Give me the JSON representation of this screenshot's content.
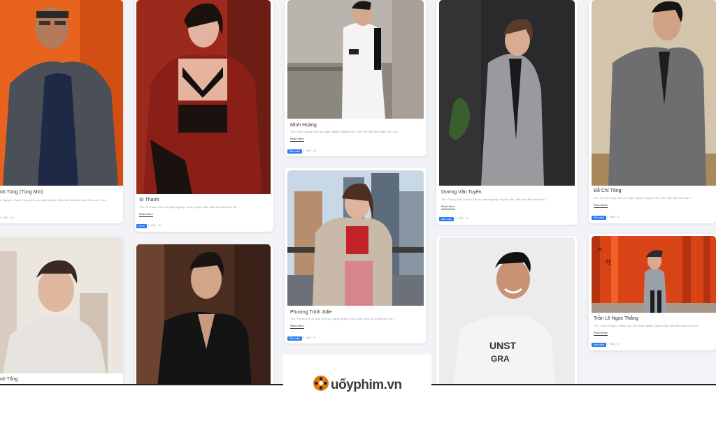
{
  "cards": {
    "c1": {
      "name": "nh Tùng (Tùng Min)",
      "desc": "n: Nguyễn Thanh Tùng Lĩnh vực nghệ nghiệp: Diễn viên Bắt bình Nam Nhu vực: HCl...",
      "stat": "2 · 6M2 · 18"
    },
    "c2": {
      "name": "SI Thanh",
      "desc": "Tên: SI Thanh Lĩnh vực nghệ nghiệp: Ca sĩ, người mẫu, diễn viên Bắt bình Nữ...",
      "readmore": "Read More",
      "badge": "Tin tổ",
      "stat": "2 · 6M2 · 16"
    },
    "c3": {
      "name": "Minh Hoàng",
      "desc": "Tên: Minh Hoàng Lĩnh vực nghệ nghiệp: Người mẫu, Diễn viên Bắt bình Nam Khu vực...",
      "readmore": "Read More",
      "badge": "Siêu mẫu",
      "stat": "2 · 6M2 · 16"
    },
    "c4": {
      "name": "Dương Văn Tuyên",
      "desc": "Tên: Dương Văn Tuyên Lĩnh vực nghệ nghiệp: Người mẫu, diễn viên Bắt bình Nam...",
      "readmore": "Read More",
      "badge": "Siêu mẫu",
      "stat": "2 · 6M2 · 16"
    },
    "c5": {
      "name": "Đỗ Chí Tông",
      "desc": "Tên: Đỗ Chí Tông Lĩnh vực nghệ nghiệp: Người mẫu, diễn viên Bắt bình Nam...",
      "readmore": "Read More",
      "badge": "Siêu mẫu",
      "stat": "2 · 6M2 · 17"
    },
    "c6": {
      "name": "nh Tổng"
    },
    "c8": {
      "name": "Phương Trinh Jolie",
      "desc": "Tên: Phương Trinh Jolie Lĩnh vực nghệ nghiệp: 2014. Diễn viên, ca sĩ Bắt bình Nữ...",
      "readmore": "Read More",
      "badge": "Siêu mẫu",
      "stat": "2 · 6M2 · 17"
    },
    "c10": {
      "name": "Trần Lê Ngọc Thắng",
      "desc": "Tên: Trần Lê Ngọc Thắng Lĩnh vực nghệ nghiệp: Người mẫu Bắt bình Nam Khu vực...",
      "readmore": "Read More",
      "badge": "Siêu mẫu",
      "stat": "2 · 6M2 · 17"
    }
  },
  "logo": {
    "text": "uốyphim.vn"
  },
  "colors": {
    "badge": "#2d7cf0",
    "background": "#f2f3f6"
  }
}
